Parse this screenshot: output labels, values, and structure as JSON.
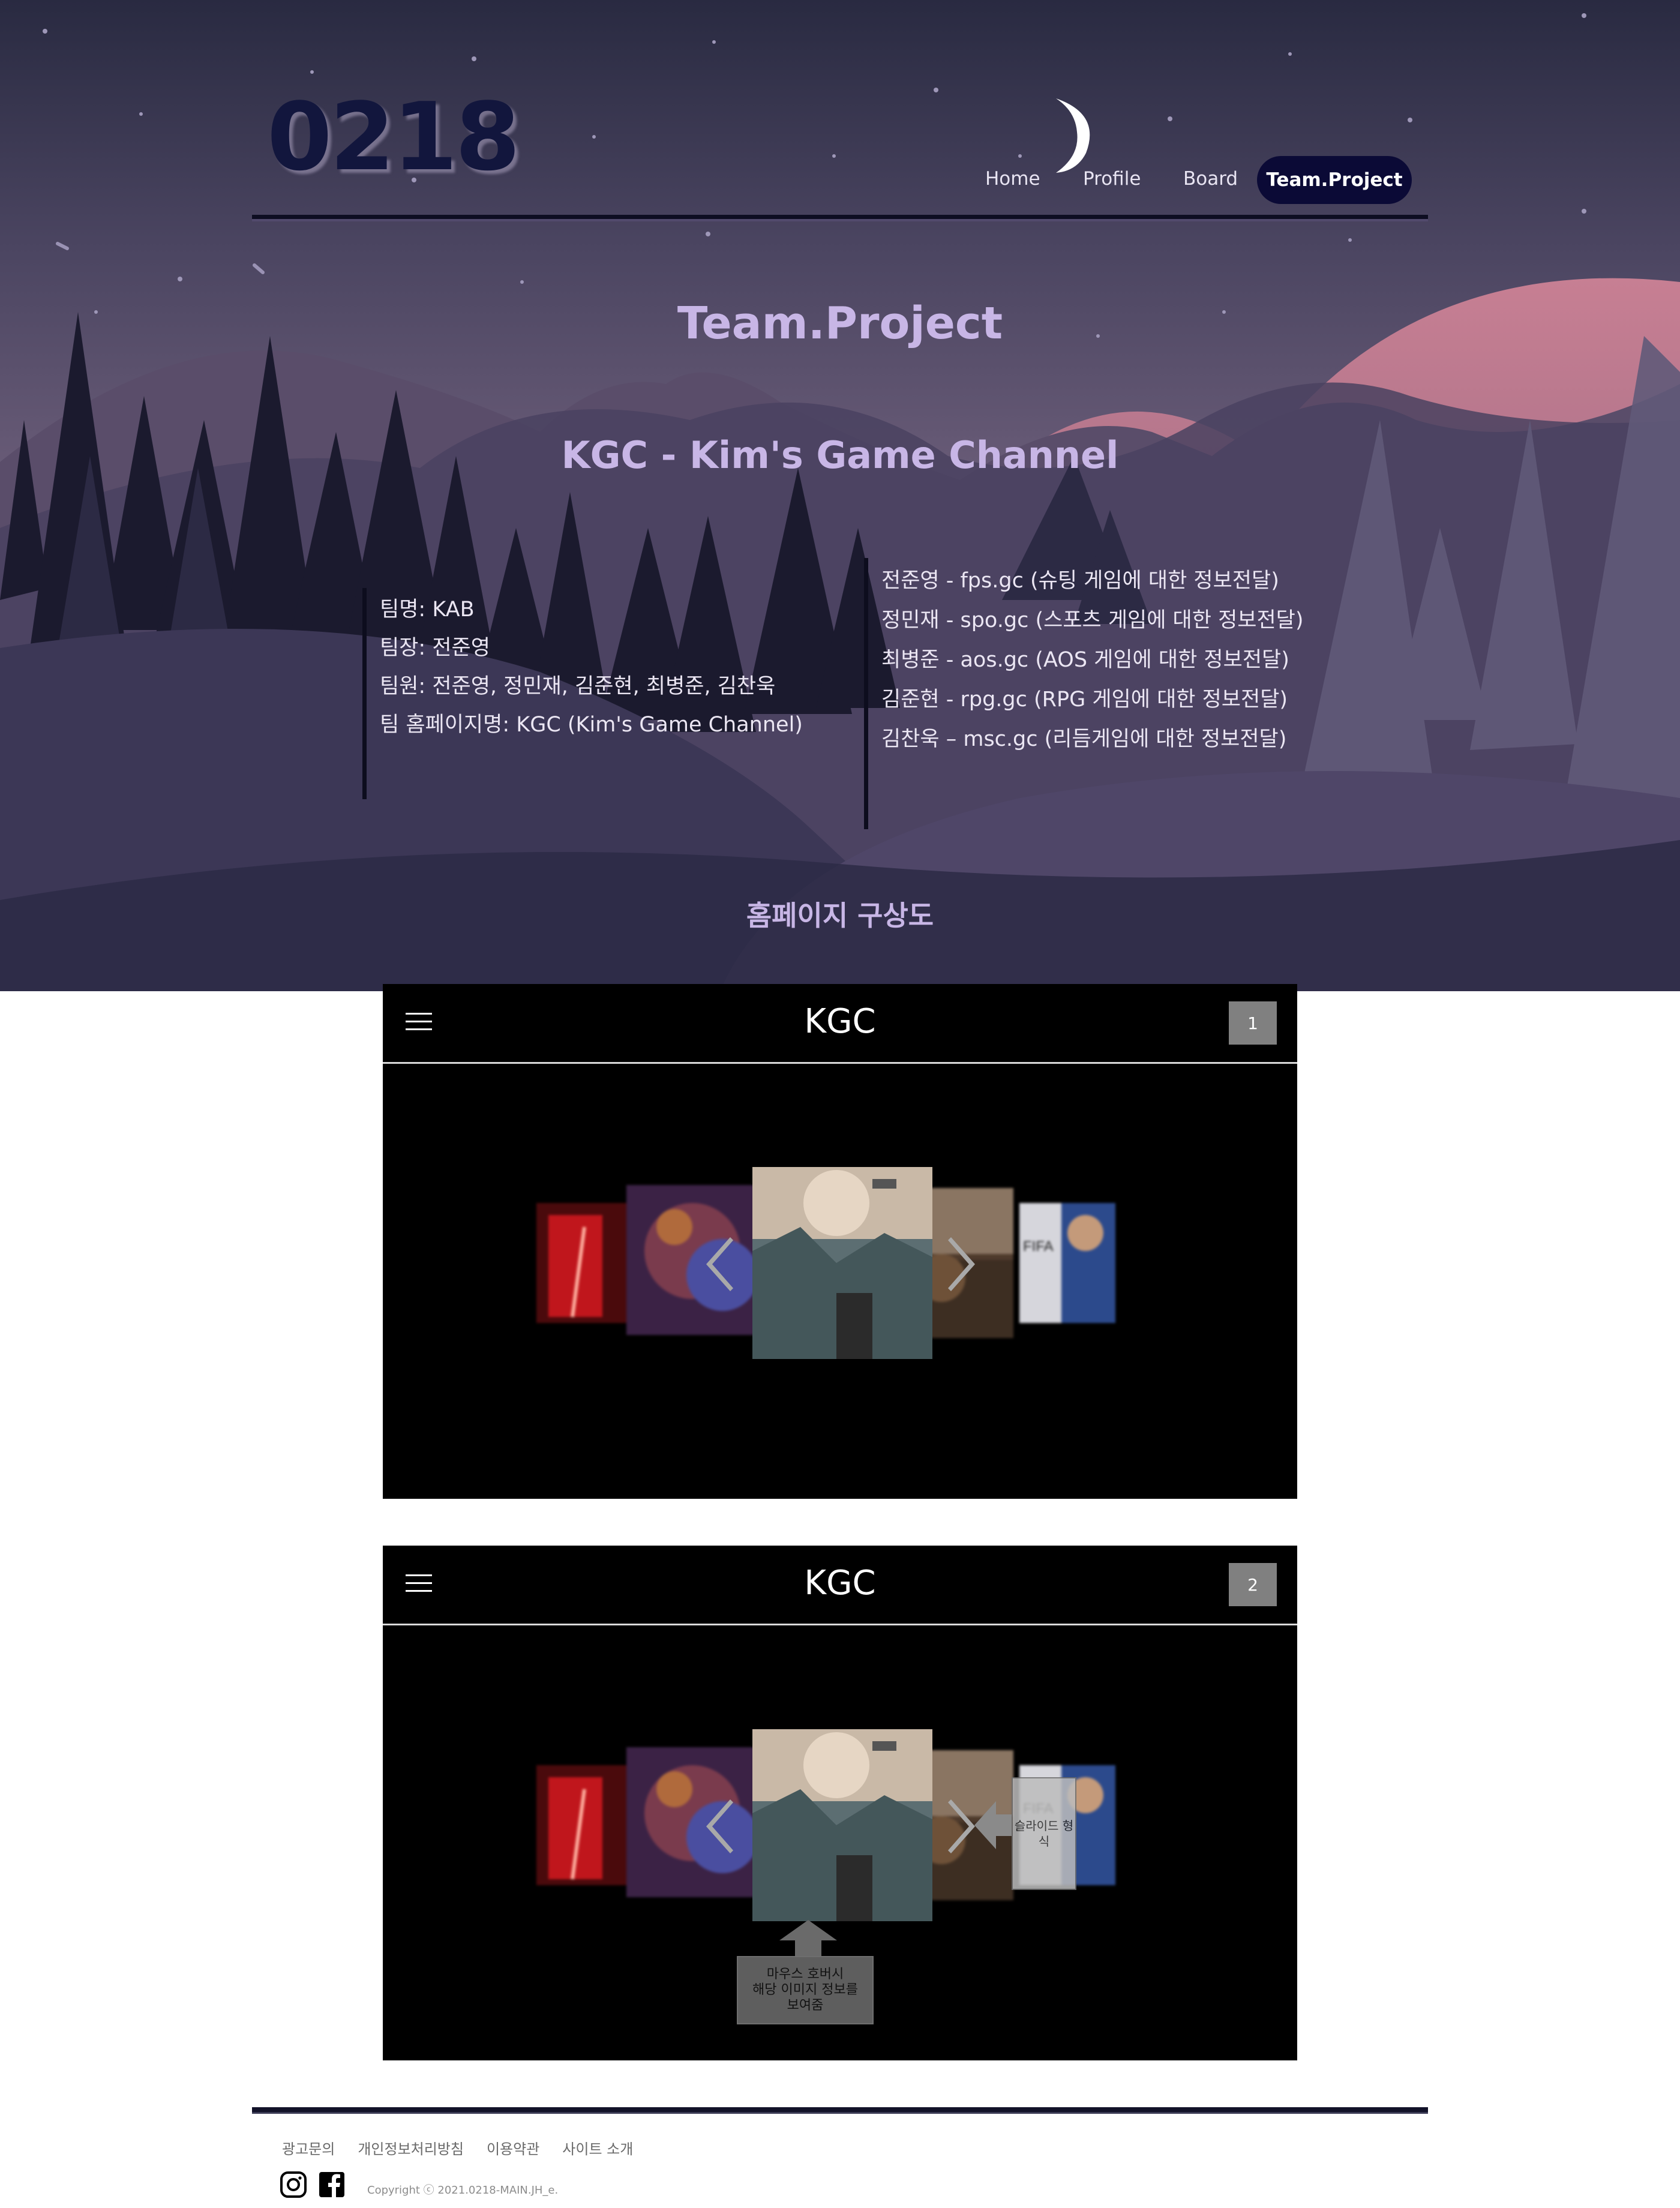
{
  "site": {
    "logo": "0218",
    "nav": [
      "Home",
      "Profile",
      "Board"
    ],
    "nav_active": "Team.Project"
  },
  "hero": {
    "title": "Team.Project",
    "subtitle": "KGC - Kim's Game Channel",
    "team_info": [
      "팀명: KAB",
      "팀장: 전준영",
      "팀원: 전준영, 정민재, 김준현, 최병준, 김찬욱",
      "팀 홈페이지명: KGC (Kim's Game Channel)"
    ],
    "members": [
      "전준영 - fps.gc (슈팅 게임에 대한 정보전달)",
      "정민재 - spo.gc (스포츠 게임에 대한 정보전달)",
      "최병준 - aos.gc (AOS 게임에 대한 정보전달)",
      "김준현 - rpg.gc (RPG 게임에 대한 정보전달)",
      "김찬욱 – msc.gc (리듬게임에 대한 정보전달)"
    ],
    "section_label": "홈페이지 구상도"
  },
  "mockups": [
    {
      "title": "KGC",
      "badge": "1"
    },
    {
      "title": "KGC",
      "badge": "2"
    }
  ],
  "annotations": {
    "slide_type": "슬라이드 형식",
    "hover_info": [
      "마우스 호버시",
      "해당 이미지 정보를",
      "보여줌"
    ]
  },
  "footer": {
    "links": [
      "광고문의",
      "개인정보처리방침",
      "이용약관",
      "사이트 소개"
    ],
    "copyright": "Copyright ⓒ 2021.0218-MAIN.JH_e."
  },
  "colors": {
    "nav_active_bg": "#0b0a36",
    "logo": "#12163d",
    "title": "#c8b6e6"
  },
  "icons": [
    "moon-icon",
    "hamburger-icon",
    "chevron-left-icon",
    "chevron-right-icon",
    "instagram-icon",
    "facebook-icon"
  ]
}
